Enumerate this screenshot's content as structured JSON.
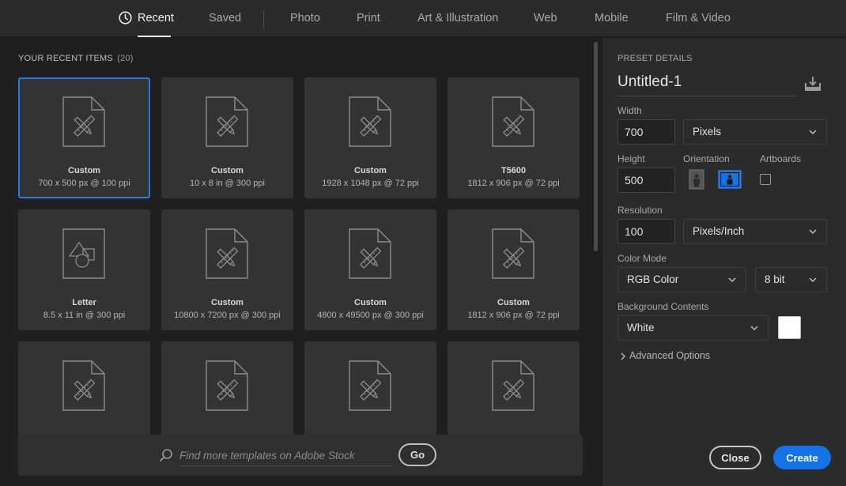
{
  "nav": {
    "tabs": [
      {
        "label": "Recent",
        "active": true,
        "icon": "clock-icon"
      },
      {
        "label": "Saved"
      },
      {
        "label": "Photo"
      },
      {
        "label": "Print"
      },
      {
        "label": "Art & Illustration"
      },
      {
        "label": "Web"
      },
      {
        "label": "Mobile"
      },
      {
        "label": "Film & Video"
      }
    ]
  },
  "recent": {
    "title": "YOUR RECENT ITEMS",
    "count": "(20)",
    "items": [
      {
        "name": "Custom",
        "desc": "700 x 500 px @ 100 ppi",
        "icon": "artboard-ruler-pencil-icon",
        "selected": true
      },
      {
        "name": "Custom",
        "desc": "10 x 8 in @ 300 ppi",
        "icon": "artboard-ruler-pencil-icon"
      },
      {
        "name": "Custom",
        "desc": "1928 x 1048 px @ 72 ppi",
        "icon": "artboard-ruler-pencil-icon"
      },
      {
        "name": "T5600",
        "desc": "1812 x 906 px @ 72 ppi",
        "icon": "artboard-ruler-pencil-icon"
      },
      {
        "name": "Letter",
        "desc": "8.5 x 11 in @ 300 ppi",
        "icon": "document-shapes-icon"
      },
      {
        "name": "Custom",
        "desc": "10800 x 7200 px @ 300 ppi",
        "icon": "artboard-ruler-pencil-icon"
      },
      {
        "name": "Custom",
        "desc": "4800 x 49500 px @ 300 ppi",
        "icon": "artboard-ruler-pencil-icon"
      },
      {
        "name": "Custom",
        "desc": "1812 x 906 px @ 72 ppi",
        "icon": "artboard-ruler-pencil-icon"
      },
      {
        "name": "",
        "desc": "",
        "icon": "artboard-ruler-pencil-icon"
      },
      {
        "name": "",
        "desc": "",
        "icon": "artboard-ruler-pencil-icon"
      },
      {
        "name": "",
        "desc": "",
        "icon": "artboard-ruler-pencil-icon"
      },
      {
        "name": "",
        "desc": "",
        "icon": "artboard-ruler-pencil-icon"
      }
    ]
  },
  "search": {
    "placeholder": "Find more templates on Adobe Stock",
    "go_label": "Go"
  },
  "preset": {
    "title": "PRESET DETAILS",
    "name": "Untitled-1",
    "width_label": "Width",
    "width_value": "700",
    "width_unit": "Pixels",
    "height_label": "Height",
    "height_value": "500",
    "orientation_label": "Orientation",
    "orientation": "landscape",
    "artboards_label": "Artboards",
    "artboards_checked": false,
    "resolution_label": "Resolution",
    "resolution_value": "100",
    "resolution_unit": "Pixels/Inch",
    "color_mode_label": "Color Mode",
    "color_mode": "RGB Color",
    "bit_depth": "8 bit",
    "background_label": "Background Contents",
    "background": "White",
    "background_color": "#ffffff",
    "advanced_label": "Advanced Options",
    "close_label": "Close",
    "create_label": "Create"
  },
  "colors": {
    "accent": "#1473e6",
    "selected_border": "#2a7ae2"
  }
}
